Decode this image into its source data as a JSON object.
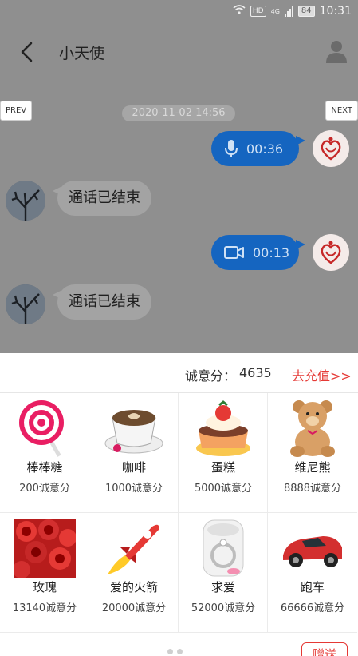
{
  "status_bar": {
    "time": "10:31",
    "battery": "84",
    "network": "4G",
    "hd": "HD"
  },
  "header": {
    "title": "小天使"
  },
  "nav": {
    "prev": "PREV",
    "next": "NEXT"
  },
  "chat": {
    "timestamp": "2020-11-02 14:56",
    "voice_duration": "00:36",
    "video_duration": "00:13",
    "call_ended_1": "通话已结束",
    "call_ended_2": "通话已结束"
  },
  "gift_panel": {
    "score_label": "诚意分：",
    "score_value": "4635",
    "recharge": "去充值>>",
    "send": "赠送",
    "gifts": [
      {
        "name": "棒棒糖",
        "price": "200诚意分",
        "icon": "lollipop-icon"
      },
      {
        "name": "咖啡",
        "price": "1000诚意分",
        "icon": "coffee-icon"
      },
      {
        "name": "蛋糕",
        "price": "5000诚意分",
        "icon": "cake-icon"
      },
      {
        "name": "维尼熊",
        "price": "8888诚意分",
        "icon": "teddy-bear-icon"
      },
      {
        "name": "玫瑰",
        "price": "13140诚意分",
        "icon": "roses-icon"
      },
      {
        "name": "爱的火箭",
        "price": "20000诚意分",
        "icon": "rocket-icon"
      },
      {
        "name": "求爱",
        "price": "52000诚意分",
        "icon": "ring-icon"
      },
      {
        "name": "跑车",
        "price": "66666诚意分",
        "icon": "sports-car-icon"
      }
    ]
  },
  "colors": {
    "accent_blue": "#1565c0",
    "accent_red": "#e53935",
    "overlay": "#8f8f8f"
  }
}
